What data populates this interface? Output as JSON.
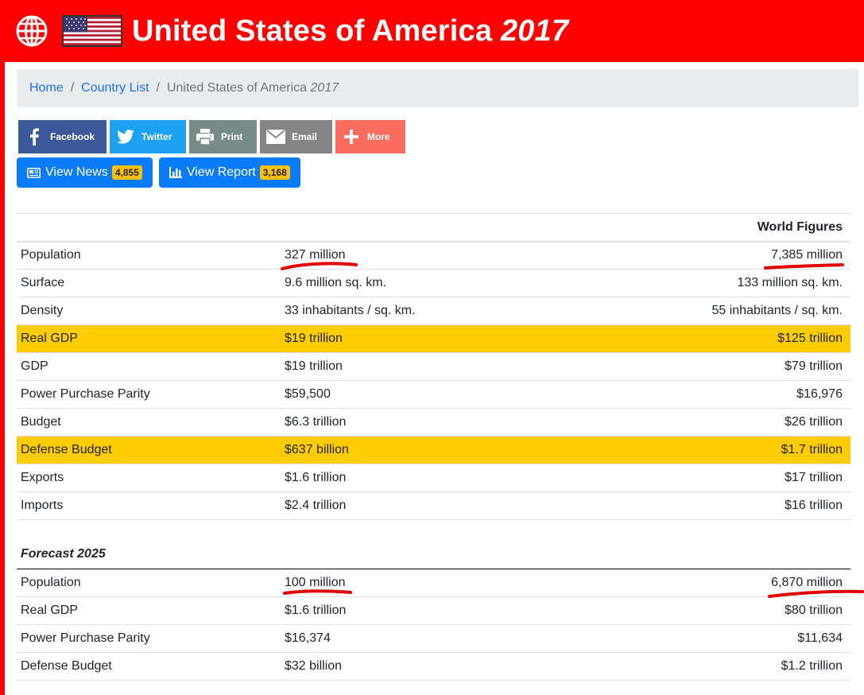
{
  "header": {
    "title": "United States of America",
    "year": "2017",
    "bg_color": "#ff0000",
    "globe_icon": "globe-icon",
    "flag_icon": "us-flag-icon"
  },
  "breadcrumb": {
    "home": "Home",
    "country_list": "Country List",
    "current": "United States of America",
    "current_year": "2017"
  },
  "share": [
    {
      "label": "Facebook",
      "icon": "facebook-icon",
      "color": "#3b5998"
    },
    {
      "label": "Twitter",
      "icon": "twitter-icon",
      "color": "#1da1f2"
    },
    {
      "label": "Print",
      "icon": "print-icon",
      "color": "#778b8b"
    },
    {
      "label": "Email",
      "icon": "email-icon",
      "color": "#848484"
    },
    {
      "label": "More",
      "icon": "plus-icon",
      "color": "#f96d5e"
    }
  ],
  "actions": {
    "news_label": "View News",
    "news_count": "4,855",
    "report_label": "View Report",
    "report_count": "3,168"
  },
  "figures": {
    "header": "World Figures",
    "rows": [
      {
        "label": "Population",
        "country": "327 million",
        "world": "7,385 million",
        "highlight": false
      },
      {
        "label": "Surface",
        "country": "9.6 million sq. km.",
        "world": "133 million sq. km.",
        "highlight": false
      },
      {
        "label": "Density",
        "country": "33 inhabitants / sq. km.",
        "world": "55 inhabitants / sq. km.",
        "highlight": false
      },
      {
        "label": "Real GDP",
        "country": "$19 trillion",
        "world": "$125 trillion",
        "highlight": true
      },
      {
        "label": "GDP",
        "country": "$19 trillion",
        "world": "$79 trillion",
        "highlight": false
      },
      {
        "label": "Power Purchase Parity",
        "country": "$59,500",
        "world": "$16,976",
        "highlight": false
      },
      {
        "label": "Budget",
        "country": "$6.3 trillion",
        "world": "$26 trillion",
        "highlight": false
      },
      {
        "label": "Defense Budget",
        "country": "$637 billion",
        "world": "$1.7 trillion",
        "highlight": true
      },
      {
        "label": "Exports",
        "country": "$1.6 trillion",
        "world": "$17 trillion",
        "highlight": false
      },
      {
        "label": "Imports",
        "country": "$2.4 trillion",
        "world": "$16 trillion",
        "highlight": false
      }
    ]
  },
  "forecast": {
    "header": "Forecast 2025",
    "rows": [
      {
        "label": "Population",
        "country": "100 million",
        "world": "6,870 million"
      },
      {
        "label": "Real GDP",
        "country": "$1.6 trillion",
        "world": "$80 trillion"
      },
      {
        "label": "Power Purchase Parity",
        "country": "$16,374",
        "world": "$11,634"
      },
      {
        "label": "Defense Budget",
        "country": "$32 billion",
        "world": "$1.2 trillion"
      }
    ]
  },
  "colors": {
    "highlight_row": "#ffcc00",
    "link": "#1a73e8",
    "primary_button": "#0a7cf7",
    "badge": "#ffc107",
    "annotation": "#e00000"
  }
}
